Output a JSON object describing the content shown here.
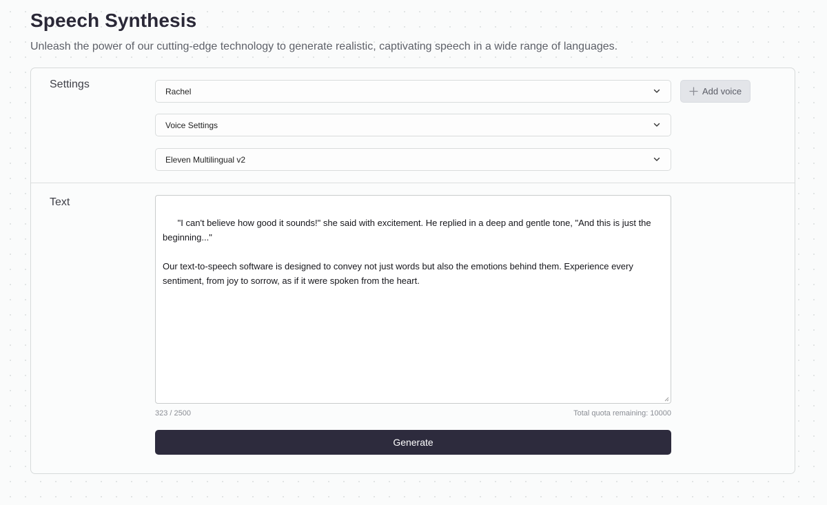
{
  "header": {
    "title": "Speech Synthesis",
    "subtitle": "Unleash the power of our cutting-edge technology to generate realistic, captivating speech in a wide range of languages."
  },
  "settings": {
    "label": "Settings",
    "voice_select": {
      "value": "Rachel",
      "icon": "chevron-down-icon"
    },
    "voice_settings_select": {
      "value": "Voice Settings",
      "icon": "chevron-down-icon"
    },
    "model_select": {
      "value": "Eleven Multilingual v2",
      "icon": "chevron-down-icon"
    },
    "add_voice": {
      "label": "Add voice",
      "icon": "plus-icon"
    }
  },
  "text_section": {
    "label": "Text",
    "value": "\"I can't believe how good it sounds!\" she said with excitement. He replied in a deep and gentle tone, \"And this is just the beginning...\"\n\nOur text-to-speech software is designed to convey not just words but also the emotions behind them. Experience every sentiment, from joy to sorrow, as if it were spoken from the heart.",
    "char_count": "323 / 2500",
    "quota": "Total quota remaining: 10000",
    "generate_label": "Generate"
  },
  "colors": {
    "primary_button": "#2d2b3d",
    "secondary_button": "#e3e5e9",
    "border": "#d7dada"
  }
}
